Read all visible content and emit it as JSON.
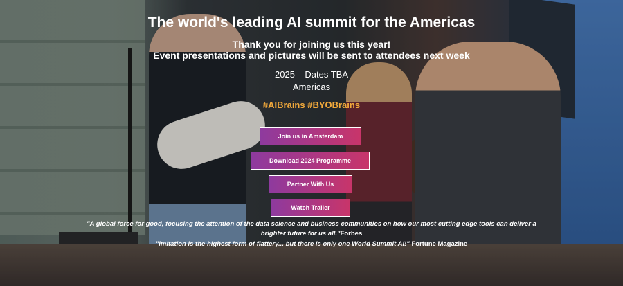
{
  "hero": {
    "title": "The world's leading AI summit for the Americas",
    "thanks_line1": "Thank you for joining us this year!",
    "thanks_line2": "Event presentations and pictures will be sent to attendees next week",
    "dates": "2025 – Dates TBA",
    "region": "Americas",
    "hashtags": "#AIBrains #BYOBrains"
  },
  "buttons": {
    "amsterdam": "Join us in Amsterdam",
    "programme": "Download 2024 Programme",
    "partner": "Partner With Us",
    "trailer": "Watch Trailer"
  },
  "quotes": [
    {
      "text": "\"A global force for good, focusing the attention of the data science and business communities on how our most cutting edge tools can deliver a brighter future for us all.\"",
      "source": "Forbes"
    },
    {
      "text": "\"Imitation is the highest form of flattery... but there is only one World Summit AI!\"",
      "source": "Fortune Magazine"
    }
  ],
  "colors": {
    "accent_gradient_start": "#8e3a9e",
    "accent_gradient_end": "#c8356a",
    "hashtag": "#f2a93b"
  }
}
